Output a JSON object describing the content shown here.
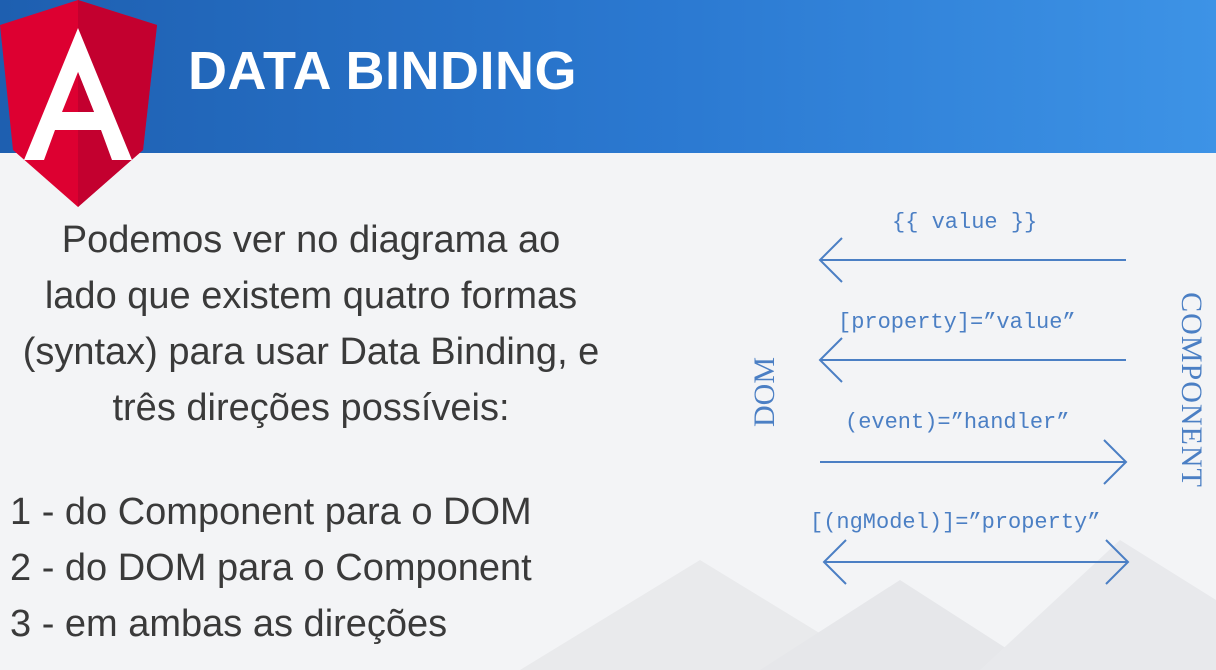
{
  "slide": {
    "title": "DATA BINDING",
    "logo_letter": "A",
    "intro_lines": [
      "Podemos ver no diagrama ao",
      "lado que existem quatro formas",
      "(syntax) para usar Data Binding, e",
      "três direções possíveis:"
    ],
    "directions": [
      "1 - do Component para o DOM",
      "2 - do DOM para o Component",
      "3 - em ambas as direções"
    ]
  },
  "diagram": {
    "left_label": "DOM",
    "right_label": "COMPONENT",
    "bindings": [
      {
        "syntax": "{{ value }}",
        "direction": "component-to-dom"
      },
      {
        "syntax": "[property]=”value”",
        "direction": "component-to-dom"
      },
      {
        "syntax": "(event)=”handler”",
        "direction": "dom-to-component"
      },
      {
        "syntax": "[(ngModel)]=”property”",
        "direction": "both"
      }
    ]
  },
  "colors": {
    "header_start": "#1e5fb0",
    "header_end": "#3d93e6",
    "angular_red": "#dd0031",
    "angular_dark_red": "#c3002f",
    "diagram_blue": "#4b7fc4",
    "text": "#3a3a3a"
  }
}
